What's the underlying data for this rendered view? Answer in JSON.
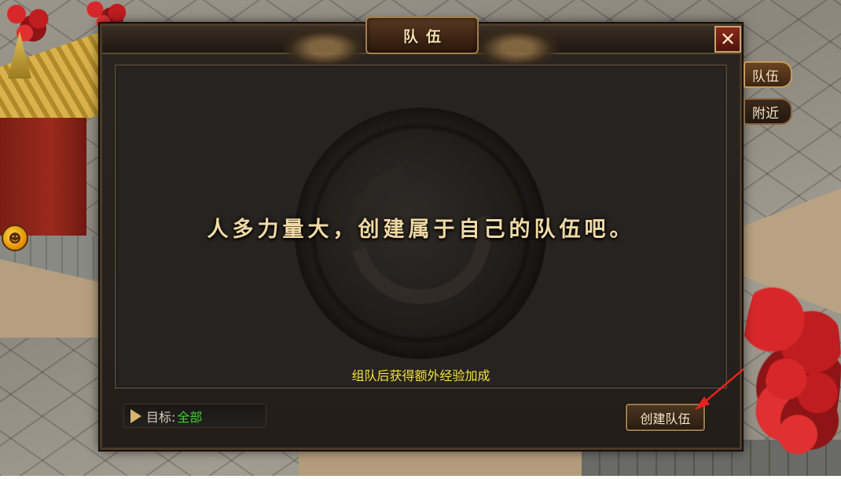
{
  "dialog": {
    "title": "队伍",
    "close_label": "✕",
    "headline": "人多力量大，创建属于自己的队伍吧。",
    "hint": "组队后获得额外经验加成",
    "target_label": "目标:",
    "target_value": "全部",
    "create_button_label": "创建队伍"
  },
  "side_tabs": [
    {
      "label": "队伍",
      "active": true
    },
    {
      "label": "附近",
      "active": false
    }
  ],
  "colors": {
    "headline": "#f1d9a4",
    "hint": "#f2e23c",
    "target_value": "#3fcf2c",
    "pointer_arrow": "#e8221c"
  },
  "icons": {
    "close": "close-icon",
    "target_arrow": "triangle-right-icon",
    "pet_badge": "pet-face-icon",
    "pointer": "red-pointer-arrow-icon"
  }
}
